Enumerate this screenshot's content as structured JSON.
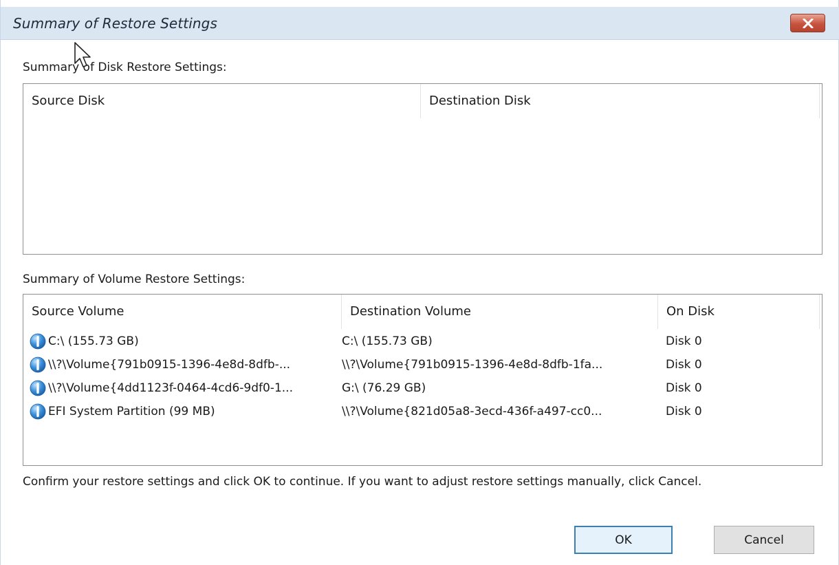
{
  "window": {
    "title": "Summary of Restore Settings"
  },
  "disk_section": {
    "label": "Summary of Disk Restore Settings:",
    "columns": [
      "Source Disk",
      "Destination Disk"
    ]
  },
  "volume_section": {
    "label": "Summary of Volume Restore Settings:",
    "columns": [
      "Source Volume",
      "Destination Volume",
      "On Disk"
    ],
    "rows": [
      {
        "icon": "volume-info-icon",
        "source": "C:\\ (155.73 GB)",
        "destination": "C:\\ (155.73 GB)",
        "disk": "Disk 0"
      },
      {
        "icon": "volume-info-icon",
        "source": "\\\\?\\Volume{791b0915-1396-4e8d-8dfb-...",
        "destination": "\\\\?\\Volume{791b0915-1396-4e8d-8dfb-1fa...",
        "disk": "Disk 0"
      },
      {
        "icon": "volume-info-icon",
        "source": "\\\\?\\Volume{4dd1123f-0464-4cd6-9df0-1...",
        "destination": "G:\\ (76.29 GB)",
        "disk": "Disk 0"
      },
      {
        "icon": "volume-info-icon",
        "source": "EFI System Partition (99 MB)",
        "destination": "\\\\?\\Volume{821d05a8-3ecd-436f-a497-cc0...",
        "disk": "Disk 0"
      }
    ]
  },
  "message": "Confirm your restore settings and click OK to continue. If you want to adjust restore settings manually, click Cancel.",
  "buttons": {
    "ok": "OK",
    "cancel": "Cancel"
  },
  "colors": {
    "titlebar": "#dbe6f3",
    "close": "#c6533d",
    "accent": "#3c7fb1"
  }
}
